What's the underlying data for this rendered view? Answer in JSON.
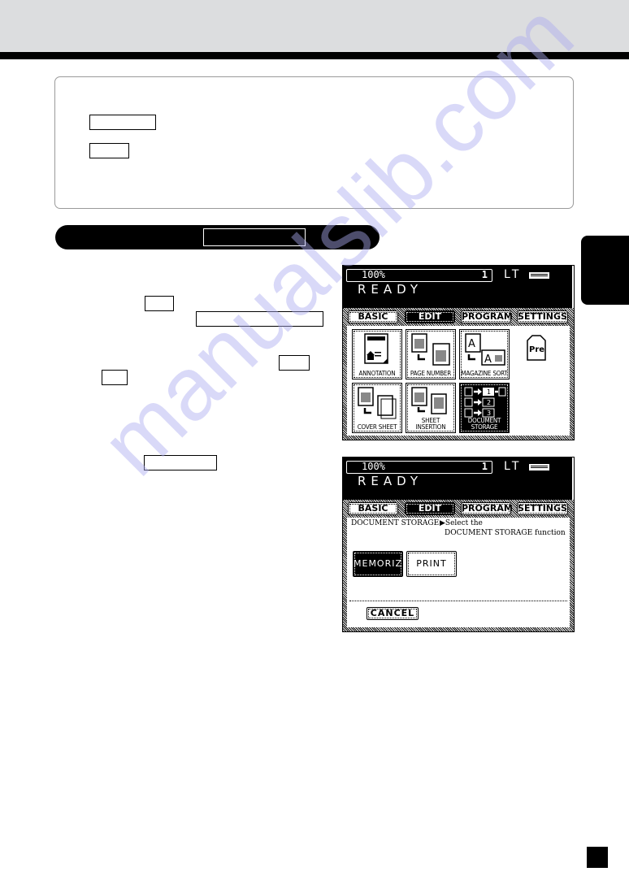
{
  "page": {
    "header_title": "",
    "watermark": "manualslib.com"
  },
  "note": {
    "key1": "",
    "key2": ""
  },
  "banner": {
    "label": ""
  },
  "steps": {
    "step1_key_a": "",
    "step1_key_b": "",
    "step1_key_c": "",
    "step1_key_d": "",
    "step2_key": ""
  },
  "panel1": {
    "zoom": "100%",
    "copies": "1",
    "paper": "LT",
    "status": "READY",
    "tabs": [
      "BASIC",
      "EDIT",
      "PROGRAM",
      "SETTINGS"
    ],
    "active_tab": "EDIT",
    "tiles": [
      {
        "label": "ANNOTATION",
        "icon": "annotation-icon"
      },
      {
        "label": "PAGE NUMBER",
        "icon": "page-number-icon"
      },
      {
        "label": "MAGAZINE SORT",
        "icon": "magazine-sort-icon"
      },
      {
        "label": "COVER SHEET",
        "icon": "cover-sheet-icon"
      },
      {
        "label": "SHEET INSERTION",
        "icon": "sheet-insertion-icon"
      },
      {
        "label": "DOCUMENT STORAGE",
        "icon": "document-storage-icon",
        "selected": true
      }
    ],
    "pre_label": "Pre"
  },
  "panel2": {
    "zoom": "100%",
    "copies": "1",
    "paper": "LT",
    "status": "READY",
    "tabs": [
      "BASIC",
      "EDIT",
      "PROGRAM",
      "SETTINGS"
    ],
    "active_tab": "EDIT",
    "function_name": "DOCUMENT STORAGE",
    "instruction_line1": "▶Select the",
    "instruction_line2": "DOCUMENT STORAGE function",
    "buttons": [
      "MEMORIZE",
      "PRINT"
    ],
    "cancel": "CANCEL"
  }
}
